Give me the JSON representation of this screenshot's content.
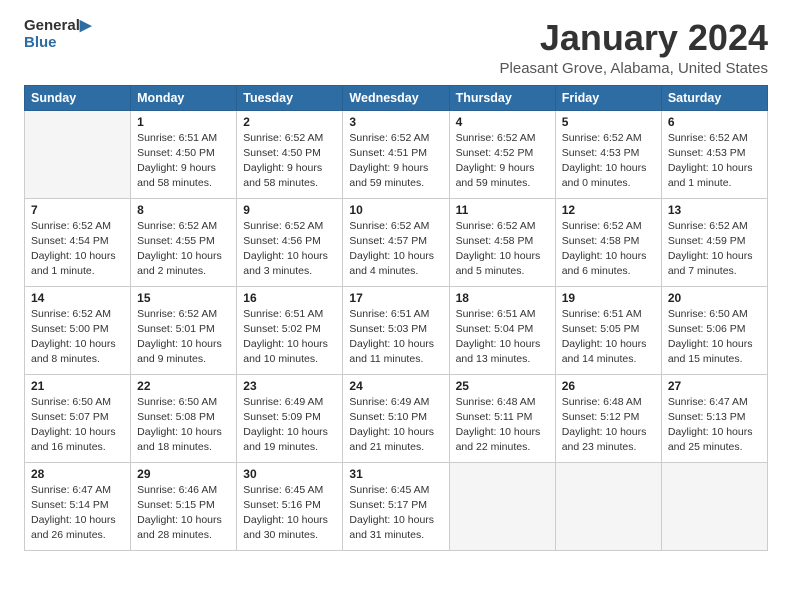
{
  "header": {
    "logo_line1": "General",
    "logo_line2": "Blue",
    "month_title": "January 2024",
    "location": "Pleasant Grove, Alabama, United States"
  },
  "weekdays": [
    "Sunday",
    "Monday",
    "Tuesday",
    "Wednesday",
    "Thursday",
    "Friday",
    "Saturday"
  ],
  "weeks": [
    [
      {
        "day": "",
        "info": ""
      },
      {
        "day": "1",
        "info": "Sunrise: 6:51 AM\nSunset: 4:50 PM\nDaylight: 9 hours\nand 58 minutes."
      },
      {
        "day": "2",
        "info": "Sunrise: 6:52 AM\nSunset: 4:50 PM\nDaylight: 9 hours\nand 58 minutes."
      },
      {
        "day": "3",
        "info": "Sunrise: 6:52 AM\nSunset: 4:51 PM\nDaylight: 9 hours\nand 59 minutes."
      },
      {
        "day": "4",
        "info": "Sunrise: 6:52 AM\nSunset: 4:52 PM\nDaylight: 9 hours\nand 59 minutes."
      },
      {
        "day": "5",
        "info": "Sunrise: 6:52 AM\nSunset: 4:53 PM\nDaylight: 10 hours\nand 0 minutes."
      },
      {
        "day": "6",
        "info": "Sunrise: 6:52 AM\nSunset: 4:53 PM\nDaylight: 10 hours\nand 1 minute."
      }
    ],
    [
      {
        "day": "7",
        "info": "Sunrise: 6:52 AM\nSunset: 4:54 PM\nDaylight: 10 hours\nand 1 minute."
      },
      {
        "day": "8",
        "info": "Sunrise: 6:52 AM\nSunset: 4:55 PM\nDaylight: 10 hours\nand 2 minutes."
      },
      {
        "day": "9",
        "info": "Sunrise: 6:52 AM\nSunset: 4:56 PM\nDaylight: 10 hours\nand 3 minutes."
      },
      {
        "day": "10",
        "info": "Sunrise: 6:52 AM\nSunset: 4:57 PM\nDaylight: 10 hours\nand 4 minutes."
      },
      {
        "day": "11",
        "info": "Sunrise: 6:52 AM\nSunset: 4:58 PM\nDaylight: 10 hours\nand 5 minutes."
      },
      {
        "day": "12",
        "info": "Sunrise: 6:52 AM\nSunset: 4:58 PM\nDaylight: 10 hours\nand 6 minutes."
      },
      {
        "day": "13",
        "info": "Sunrise: 6:52 AM\nSunset: 4:59 PM\nDaylight: 10 hours\nand 7 minutes."
      }
    ],
    [
      {
        "day": "14",
        "info": "Sunrise: 6:52 AM\nSunset: 5:00 PM\nDaylight: 10 hours\nand 8 minutes."
      },
      {
        "day": "15",
        "info": "Sunrise: 6:52 AM\nSunset: 5:01 PM\nDaylight: 10 hours\nand 9 minutes."
      },
      {
        "day": "16",
        "info": "Sunrise: 6:51 AM\nSunset: 5:02 PM\nDaylight: 10 hours\nand 10 minutes."
      },
      {
        "day": "17",
        "info": "Sunrise: 6:51 AM\nSunset: 5:03 PM\nDaylight: 10 hours\nand 11 minutes."
      },
      {
        "day": "18",
        "info": "Sunrise: 6:51 AM\nSunset: 5:04 PM\nDaylight: 10 hours\nand 13 minutes."
      },
      {
        "day": "19",
        "info": "Sunrise: 6:51 AM\nSunset: 5:05 PM\nDaylight: 10 hours\nand 14 minutes."
      },
      {
        "day": "20",
        "info": "Sunrise: 6:50 AM\nSunset: 5:06 PM\nDaylight: 10 hours\nand 15 minutes."
      }
    ],
    [
      {
        "day": "21",
        "info": "Sunrise: 6:50 AM\nSunset: 5:07 PM\nDaylight: 10 hours\nand 16 minutes."
      },
      {
        "day": "22",
        "info": "Sunrise: 6:50 AM\nSunset: 5:08 PM\nDaylight: 10 hours\nand 18 minutes."
      },
      {
        "day": "23",
        "info": "Sunrise: 6:49 AM\nSunset: 5:09 PM\nDaylight: 10 hours\nand 19 minutes."
      },
      {
        "day": "24",
        "info": "Sunrise: 6:49 AM\nSunset: 5:10 PM\nDaylight: 10 hours\nand 21 minutes."
      },
      {
        "day": "25",
        "info": "Sunrise: 6:48 AM\nSunset: 5:11 PM\nDaylight: 10 hours\nand 22 minutes."
      },
      {
        "day": "26",
        "info": "Sunrise: 6:48 AM\nSunset: 5:12 PM\nDaylight: 10 hours\nand 23 minutes."
      },
      {
        "day": "27",
        "info": "Sunrise: 6:47 AM\nSunset: 5:13 PM\nDaylight: 10 hours\nand 25 minutes."
      }
    ],
    [
      {
        "day": "28",
        "info": "Sunrise: 6:47 AM\nSunset: 5:14 PM\nDaylight: 10 hours\nand 26 minutes."
      },
      {
        "day": "29",
        "info": "Sunrise: 6:46 AM\nSunset: 5:15 PM\nDaylight: 10 hours\nand 28 minutes."
      },
      {
        "day": "30",
        "info": "Sunrise: 6:45 AM\nSunset: 5:16 PM\nDaylight: 10 hours\nand 30 minutes."
      },
      {
        "day": "31",
        "info": "Sunrise: 6:45 AM\nSunset: 5:17 PM\nDaylight: 10 hours\nand 31 minutes."
      },
      {
        "day": "",
        "info": ""
      },
      {
        "day": "",
        "info": ""
      },
      {
        "day": "",
        "info": ""
      }
    ]
  ]
}
